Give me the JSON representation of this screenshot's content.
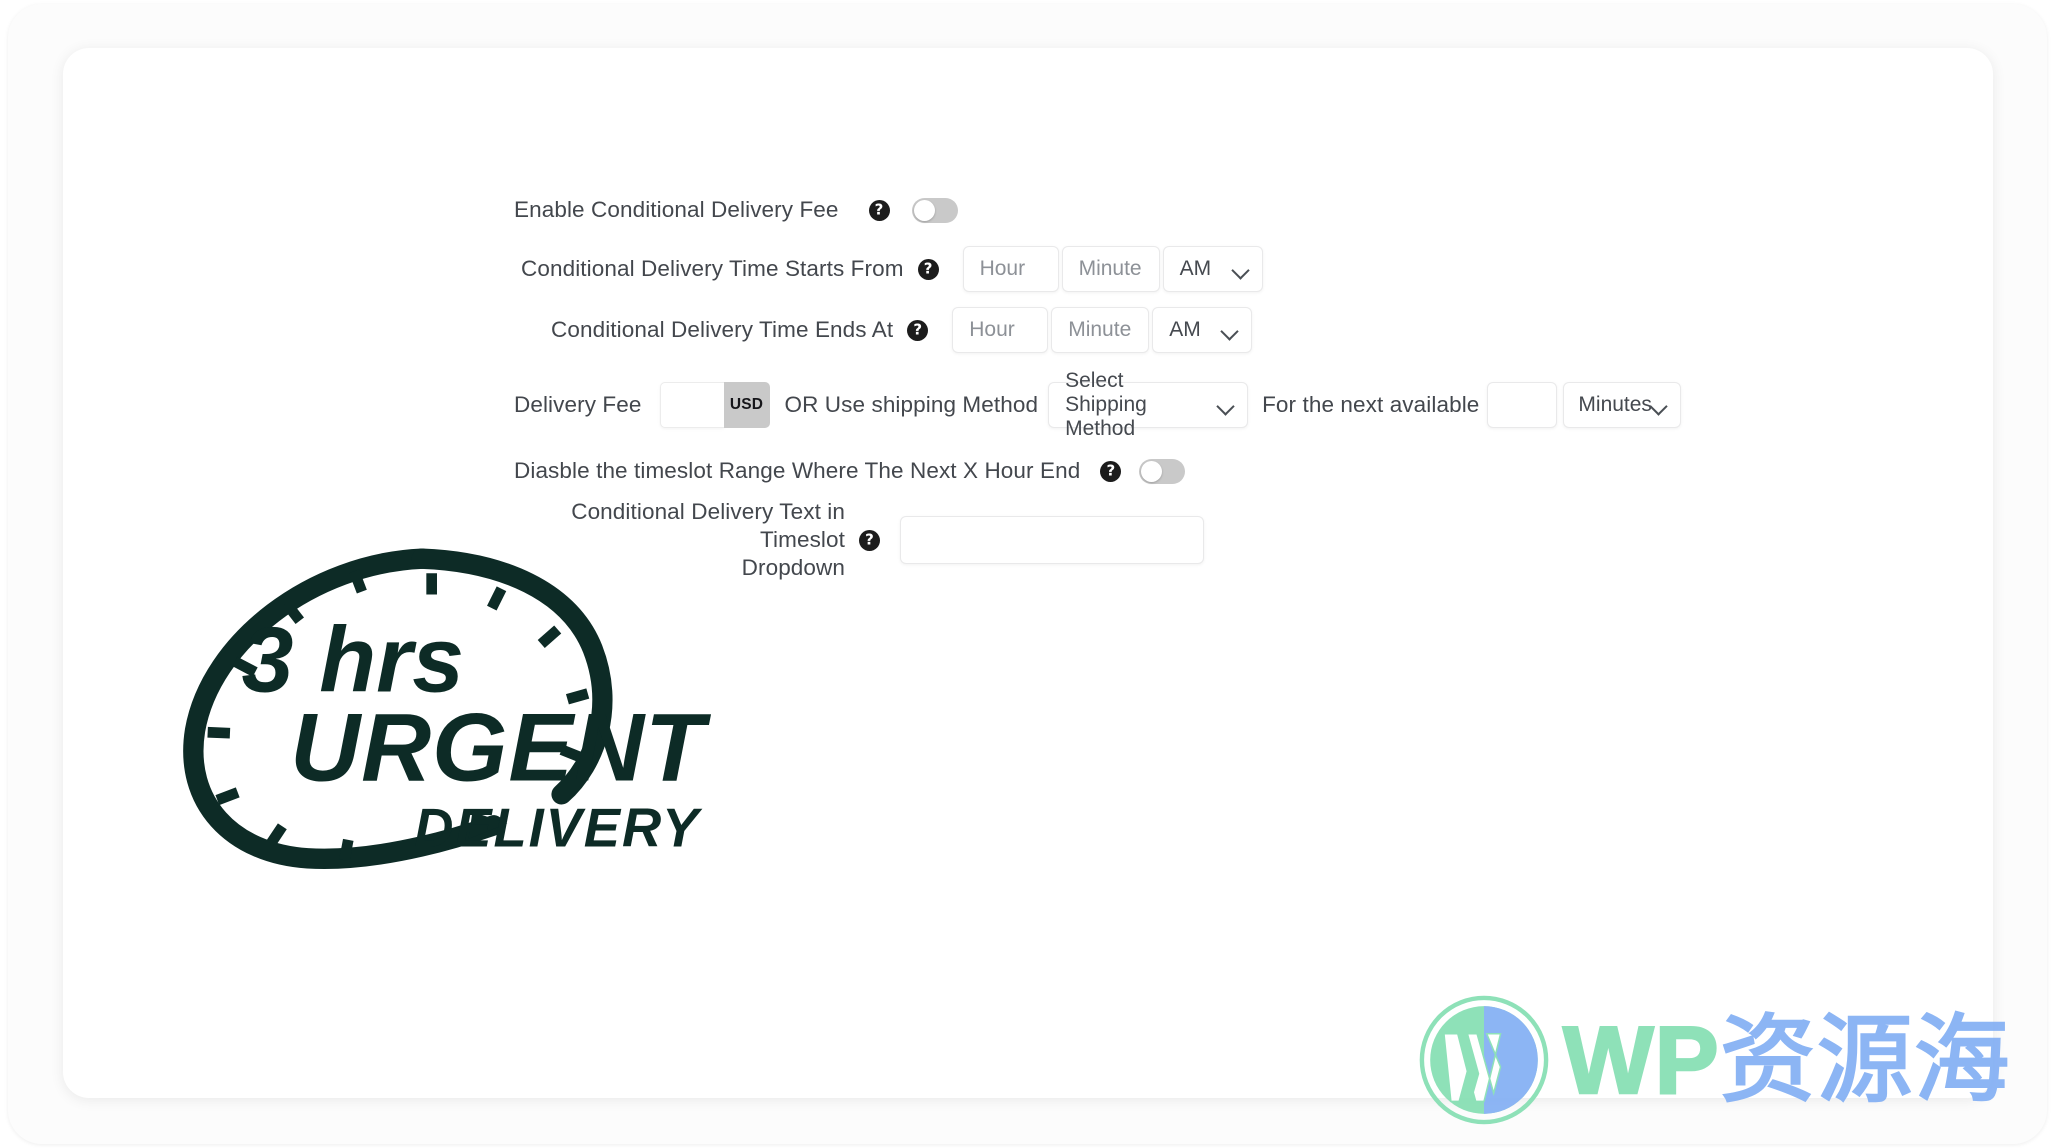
{
  "form": {
    "rows": [
      {
        "label": "Enable Conditional Delivery Fee",
        "help": "?",
        "toggle_state": "off"
      },
      {
        "label": "Conditional Delivery Time Starts From",
        "help": "?",
        "hour_placeholder": "Hour",
        "minute_placeholder": "Minute",
        "meridiem_value": "AM"
      },
      {
        "label": "Conditional Delivery Time Ends At",
        "help": "?",
        "hour_placeholder": "Hour",
        "minute_placeholder": "Minute",
        "meridiem_value": "AM"
      }
    ],
    "fee_row": {
      "label": "Delivery Fee",
      "fee_value": "",
      "currency_unit": "USD",
      "or_text": "OR Use shipping Method",
      "shipping_method_value": "Select Shipping Method",
      "next_available_text": "For the next available",
      "next_available_value": "",
      "unit_value": "Minutes"
    },
    "disable_row": {
      "label": "Diasble the timeslot Range Where The Next X Hour End",
      "help": "?",
      "toggle_state": "off"
    },
    "text_row": {
      "label_line1": "Conditional Delivery Text in Timeslot",
      "label_line2": "Dropdown",
      "help": "?",
      "value": ""
    }
  },
  "logo": {
    "hours_text": "3 hrs",
    "urgent_text": "URGENT",
    "delivery_text": "DELIVERY",
    "color": "#0d2b26"
  },
  "watermark": {
    "wp_text": "WP",
    "cn_text": "资源海",
    "wp_color": "#86dfb3",
    "cn_color": "#84b0f4",
    "mark_name": "wordpress-logo"
  }
}
